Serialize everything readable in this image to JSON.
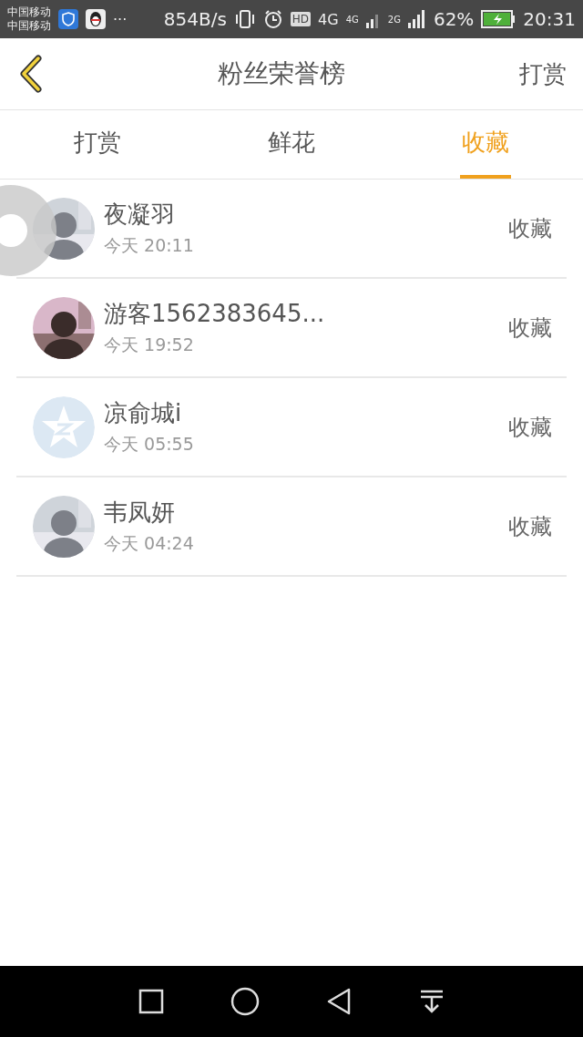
{
  "status_bar": {
    "carriers": [
      "中国移动",
      "中国移动"
    ],
    "more": "···",
    "speed": "854B/s",
    "hd": "HD",
    "network_1": "4G",
    "network_2": "4G",
    "network_3": "2G",
    "battery": "62%",
    "time": "20:31"
  },
  "header": {
    "title": "粉丝荣誉榜",
    "action": "打赏"
  },
  "tabs": [
    {
      "label": "打赏",
      "selected": false
    },
    {
      "label": "鲜花",
      "selected": false
    },
    {
      "label": "收藏",
      "selected": true
    }
  ],
  "fans": [
    {
      "name": "夜凝羽",
      "time": "今天 20:11",
      "action": "收藏"
    },
    {
      "name": "游客1562383645...",
      "time": "今天 19:52",
      "action": "收藏"
    },
    {
      "name": "凉俞城i",
      "time": "今天 05:55",
      "action": "收藏",
      "avatar": {
        "kind": "default"
      }
    },
    {
      "name": "韦凤妍",
      "time": "今天 04:24",
      "action": "收藏"
    }
  ]
}
